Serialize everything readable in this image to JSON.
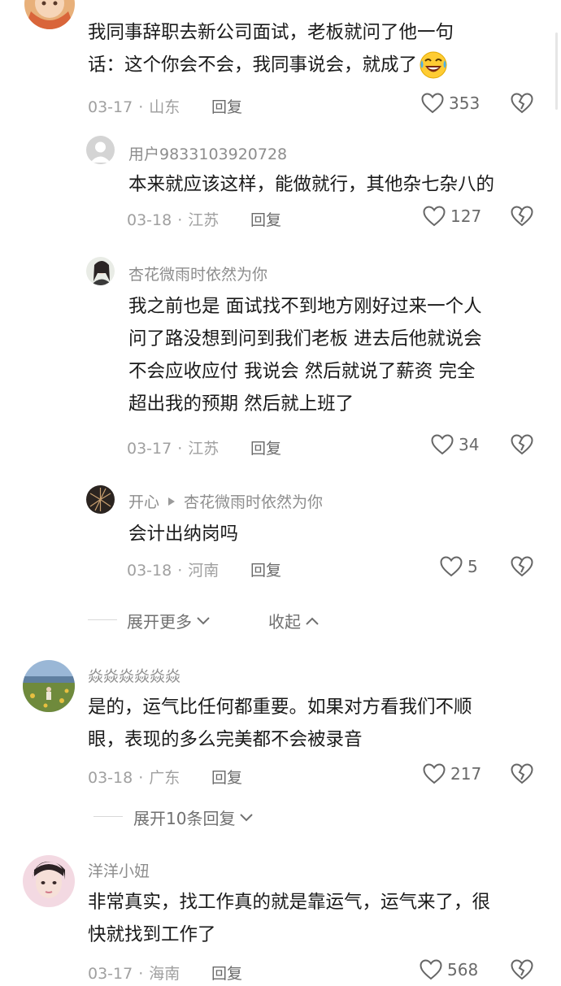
{
  "comments": [
    {
      "text_lines": [
        "我同事辞职去新公司面试，老板就问了他一句",
        "话：这个你会不会，我同事说会，就成了"
      ],
      "emoji": "laughing-crying-emoji",
      "date": "03-17",
      "region": "山东",
      "reply": "回复",
      "likes": "353"
    },
    {
      "username": "用户9833103920728",
      "text_lines": [
        "本来就应该这样，能做就行，其他杂七杂八的"
      ],
      "date": "03-18",
      "region": "江苏",
      "reply": "回复",
      "likes": "127"
    },
    {
      "username": "杏花微雨时依然为你",
      "text_lines": [
        "我之前也是 面试找不到地方刚好过来一个人",
        "问了路没想到问到我们老板 进去后他就说会",
        "不会应收应付 我说会 然后就说了薪资 完全",
        "超出我的预期 然后就上班了"
      ],
      "date": "03-17",
      "region": "江苏",
      "reply": "回复",
      "likes": "34"
    },
    {
      "username": "开心",
      "reply_to": "杏花微雨时依然为你",
      "text_lines": [
        "会计出纳岗吗"
      ],
      "date": "03-18",
      "region": "河南",
      "reply": "回复",
      "likes": "5"
    },
    {
      "username": "焱焱焱焱焱焱",
      "text_lines": [
        "是的，运气比任何都重要。如果对方看我们不顺",
        "眼，表现的多么完美都不会被录音"
      ],
      "date": "03-18",
      "region": "广东",
      "reply": "回复",
      "likes": "217"
    },
    {
      "username": "洋洋小妞",
      "text_lines": [
        "非常真实，找工作真的就是靠运气，运气来了，很",
        "快就找到工作了"
      ],
      "date": "03-17",
      "region": "海南",
      "reply": "回复",
      "likes": "568"
    }
  ],
  "expand_more": "展开更多",
  "collapse": "收起",
  "expand_replies": "展开10条回复",
  "meta_separator": "·",
  "colors": {
    "text": "#1a1a1a",
    "meta": "#a0a0a0",
    "username": "#8d8d8d",
    "background": "#ffffff"
  }
}
